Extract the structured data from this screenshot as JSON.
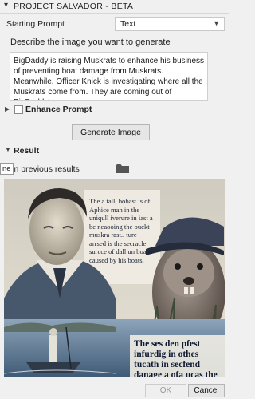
{
  "window": {
    "title": "PROJECT SALVADOR - BETA",
    "collapse_icon": "chevron-down-icon"
  },
  "starting_prompt": {
    "label": "Starting Prompt",
    "selected": "Text"
  },
  "description": {
    "label": "Describe the image you want to generate",
    "value": "BigDaddy is raising Muskrats to enhance his business of preventing boat damage from Muskrats. Meanwhile, Officer Knick is investigating where all the Muskrats come from. They are coming out of BigDaddy's garage."
  },
  "enhance": {
    "label": "Enhance Prompt",
    "checked": false
  },
  "generate_button": "Generate Image",
  "result": {
    "label": "Result",
    "open_previous": "pen previous results",
    "tooltip": "ne"
  },
  "generated_image": {
    "text_block_1": "The a tall, bobast is of Aphice man in the uniqull iverure in iast a be neaooing the ouckt muskra rast.. ture arrsed is the secracle surcce of dall un boatts caused by his boats.",
    "text_block_2": "The ses den pfest infurdig in othes tucath in secfend danage a ofa ucas the boats"
  },
  "footer": {
    "ok": "OK",
    "cancel": "Cancel"
  }
}
